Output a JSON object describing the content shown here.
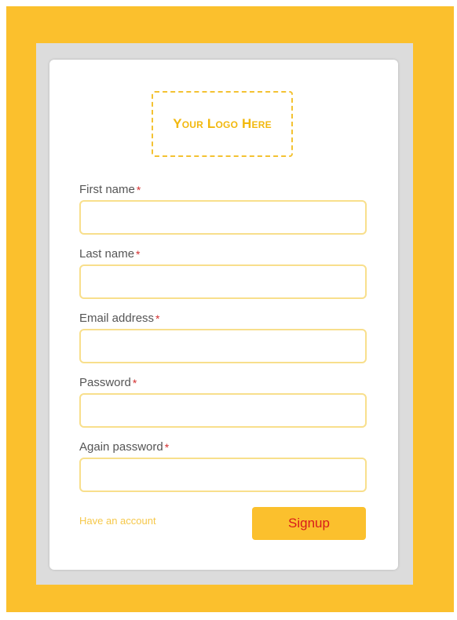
{
  "logo": {
    "text": "Your Logo Here"
  },
  "form": {
    "fields": [
      {
        "label": "First name",
        "required_mark": "*",
        "value": "",
        "placeholder": ""
      },
      {
        "label": "Last name",
        "required_mark": "*",
        "value": "",
        "placeholder": ""
      },
      {
        "label": "Email address",
        "required_mark": "*",
        "value": "",
        "placeholder": ""
      },
      {
        "label": "Password",
        "required_mark": "*",
        "value": "",
        "placeholder": ""
      },
      {
        "label": "Again password",
        "required_mark": "*",
        "value": "",
        "placeholder": ""
      }
    ],
    "have_account_link": "Have an account",
    "signup_button": "Signup"
  },
  "colors": {
    "background": "#fbc02d",
    "accent": "#fbc02d",
    "input_border": "#f8df8c",
    "required": "#d32f2f",
    "button_text": "#d81b1b"
  }
}
